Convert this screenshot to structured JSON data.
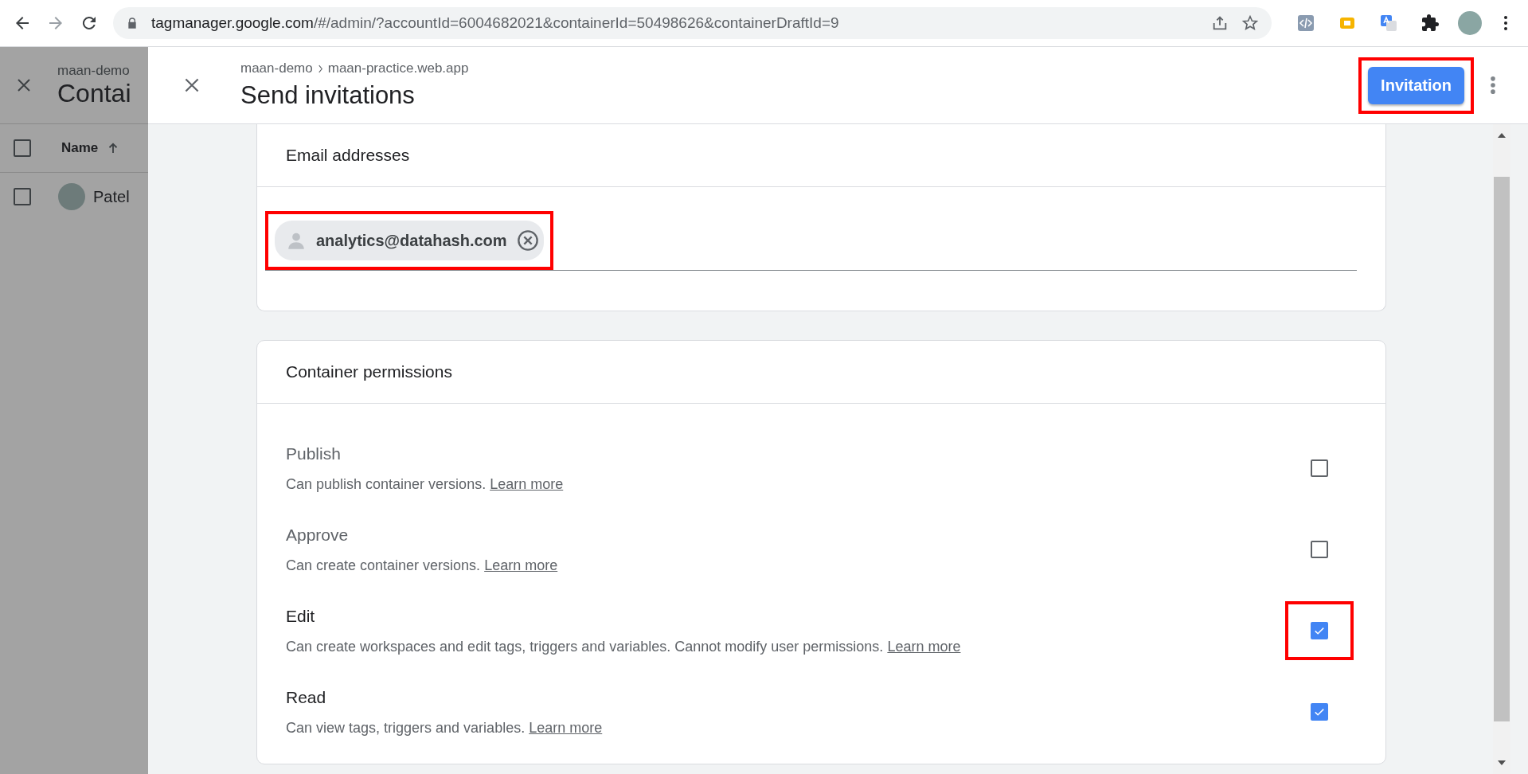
{
  "browser": {
    "url_host": "tagmanager.google.com",
    "url_path": "/#/admin/?accountId=6004682021&containerId=50498626&containerDraftId=9"
  },
  "background_page": {
    "account": "maan-demo",
    "title": "Contai",
    "column_header": "Name",
    "all_checked": false,
    "rows": [
      {
        "name": "Patel",
        "checked": false
      }
    ]
  },
  "dialog": {
    "breadcrumb": [
      "maan-demo",
      "maan-practice.web.app"
    ],
    "title": "Send invitations",
    "primary_button": {
      "label": "Invitation",
      "highlighted": true
    },
    "email_card": {
      "heading": "Email addresses",
      "chips": [
        {
          "email": "analytics@datahash.com",
          "highlighted": true
        }
      ]
    },
    "permissions_card": {
      "heading": "Container permissions",
      "permissions": [
        {
          "name": "Publish",
          "description": "Can publish container versions.",
          "link": "Learn more",
          "checked": false,
          "highlighted": false
        },
        {
          "name": "Approve",
          "description": "Can create container versions.",
          "link": "Learn more",
          "checked": false,
          "highlighted": false
        },
        {
          "name": "Edit",
          "description": "Can create workspaces and edit tags, triggers and variables. Cannot modify user permissions.",
          "link": "Learn more",
          "checked": true,
          "highlighted": true
        },
        {
          "name": "Read",
          "description": "Can view tags, triggers and variables.",
          "link": "Learn more",
          "checked": true,
          "highlighted": false
        }
      ]
    }
  }
}
